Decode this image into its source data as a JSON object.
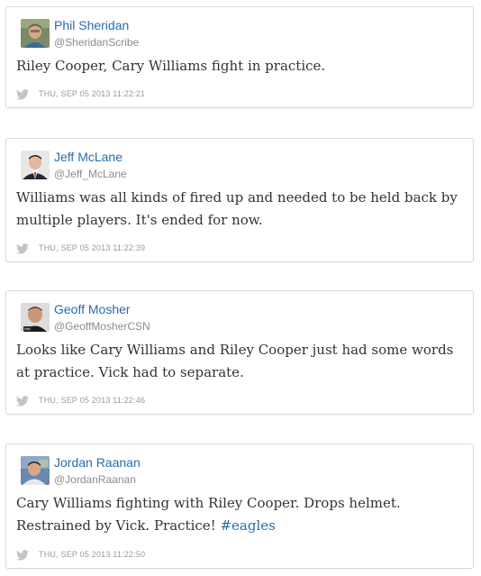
{
  "tweets": [
    {
      "author": "Phil Sheridan",
      "handle": "@SheridanScribe",
      "text": "Riley Cooper, Cary Williams fight in practice.",
      "timestamp": "THU, SEP 05 2013 11:22:21"
    },
    {
      "author": "Jeff McLane",
      "handle": "@Jeff_McLane",
      "text": "Williams was all kinds of fired up and needed to be held back by multiple players. It's ended for now.",
      "timestamp": "THU, SEP 05 2013 11:22:39"
    },
    {
      "author": "Geoff Mosher",
      "handle": "@GeoffMosherCSN",
      "text": "Looks like Cary Williams and Riley Cooper just had some words at practice. Vick had to separate.",
      "timestamp": "THU, SEP 05 2013 11:22:46"
    },
    {
      "author": "Jordan Raanan",
      "handle": "@JordanRaanan",
      "text": "Cary Williams fighting with Riley Cooper. Drops helmet. Restrained by Vick. Practice! ",
      "hashtag": "#eagles",
      "timestamp": "THU, SEP 05 2013 11:22:50"
    }
  ],
  "colors": {
    "link": "#2a6ca8",
    "meta": "#9a9a9a",
    "body_text": "#333333",
    "border": "#d9d9d9"
  },
  "icons": {
    "source": "twitter-bird-icon"
  }
}
